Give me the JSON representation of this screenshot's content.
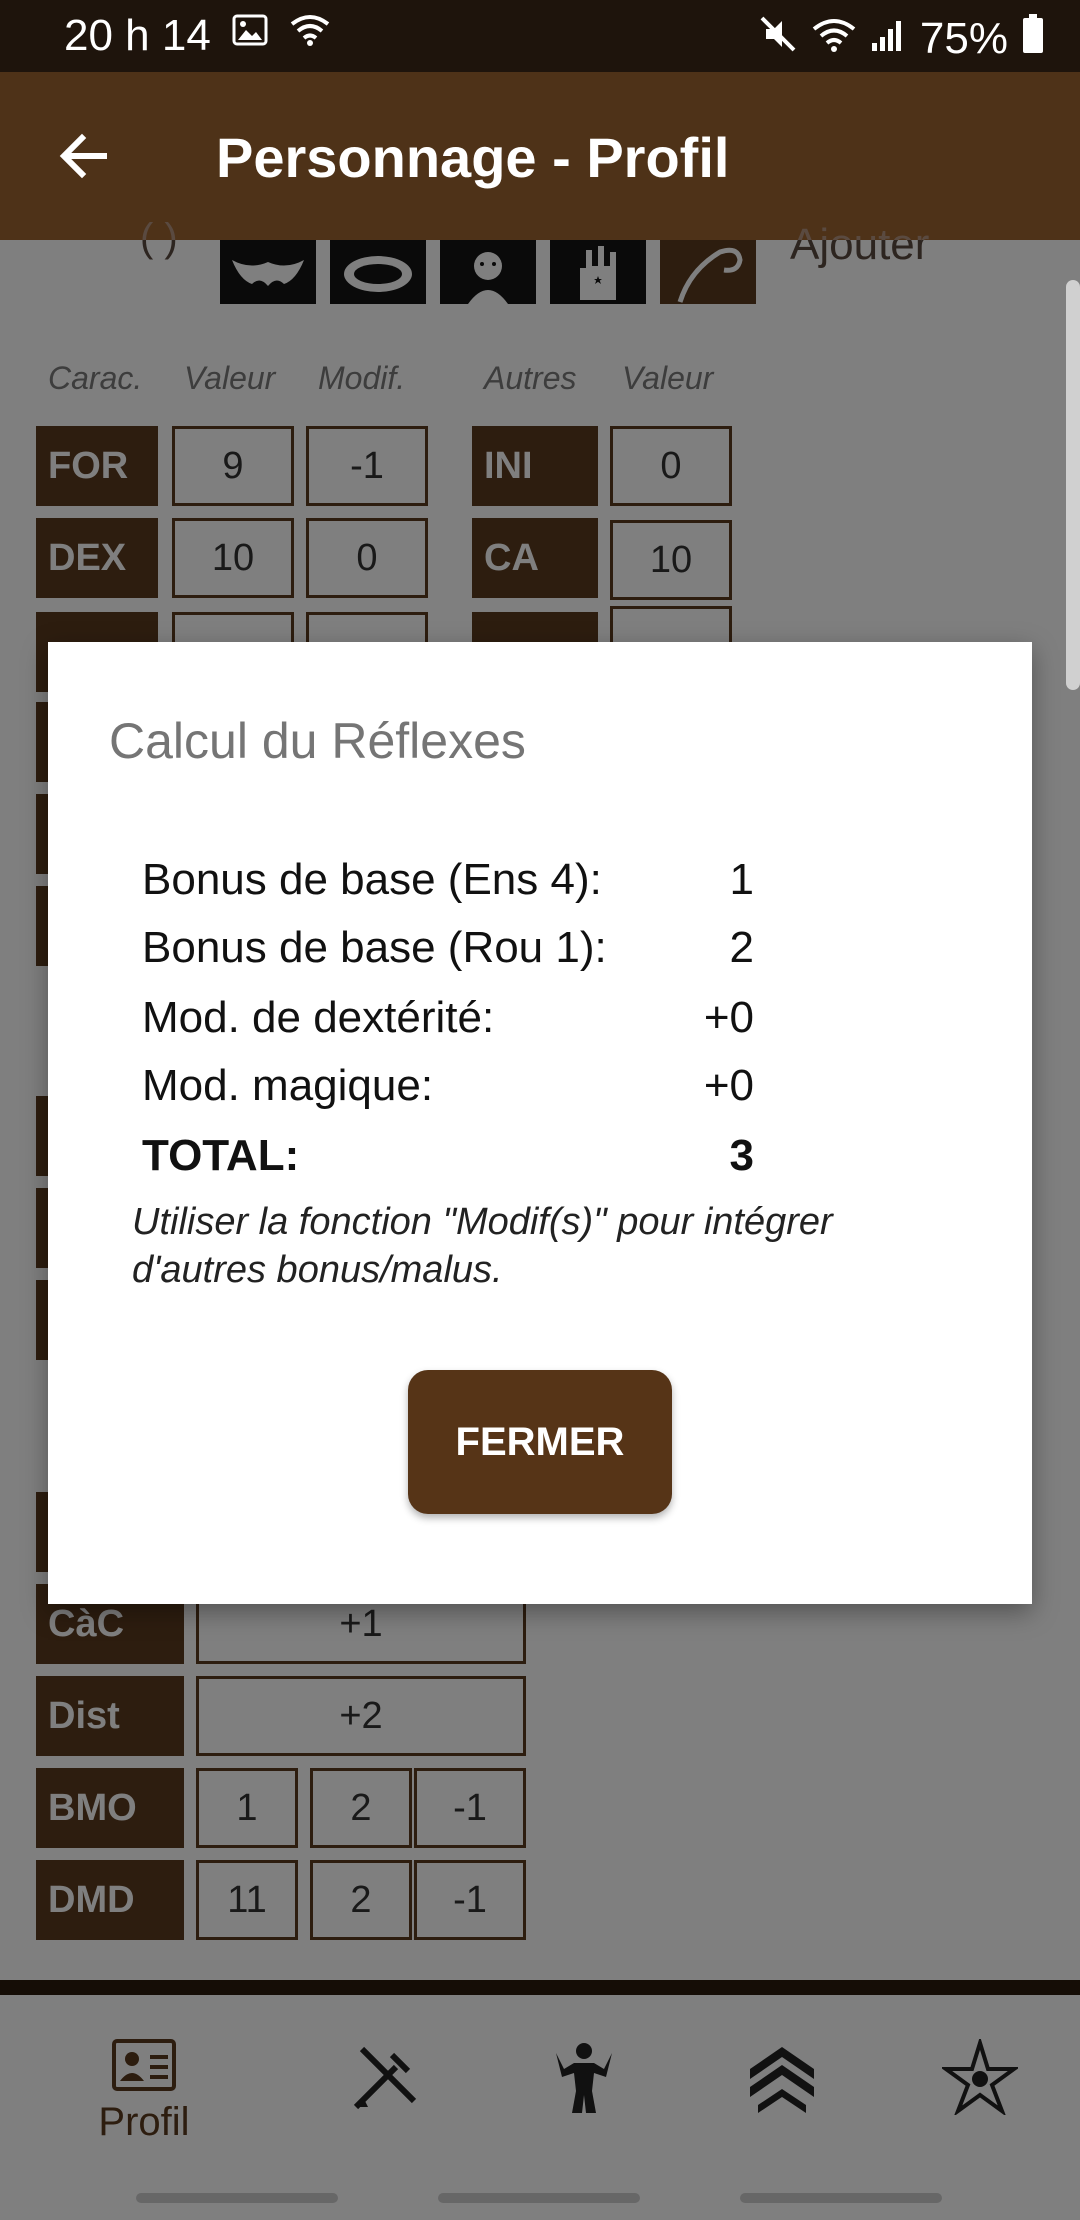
{
  "status_bar": {
    "time": "20 h 14",
    "battery": "75%",
    "left_icons": [
      "image-icon",
      "wifi-icon"
    ],
    "right_icons": [
      "mute-icon",
      "wifi-icon",
      "signal-icon",
      "battery-icon"
    ]
  },
  "app_bar": {
    "title": "Personnage - Profil",
    "back_icon": "arrow-left-icon"
  },
  "page": {
    "paren_text": "( )",
    "add_label": "Ajouter",
    "headers": {
      "carac": "Carac.",
      "valeur": "Valeur",
      "modif": "Modif.",
      "autres": "Autres",
      "valeur2": "Valeur"
    },
    "stats": [
      {
        "label": "FOR",
        "value": "9",
        "modif": "-1"
      },
      {
        "label": "DEX",
        "value": "10",
        "modif": "0"
      }
    ],
    "others": [
      {
        "label": "INI",
        "value": "0"
      },
      {
        "label": "CA",
        "value": "10"
      }
    ],
    "combat": [
      {
        "label": "CàC",
        "value": "+1"
      },
      {
        "label": "Dist",
        "value": "+2"
      }
    ],
    "maneuvers": [
      {
        "label": "BMO",
        "a": "1",
        "b": "2",
        "c": "-1"
      },
      {
        "label": "DMD",
        "a": "11",
        "b": "2",
        "c": "-1"
      }
    ]
  },
  "dialog": {
    "title": "Calcul du Réflexes",
    "rows": [
      {
        "label": "Bonus de base (Ens 4):",
        "value": "1"
      },
      {
        "label": "Bonus de base (Rou 1):",
        "value": "2"
      },
      {
        "label": "Mod. de dextérité:",
        "value": "+0"
      },
      {
        "label": "Mod. magique:",
        "value": "+0"
      }
    ],
    "total": {
      "label": "TOTAL:",
      "value": "3"
    },
    "note": "Utiliser la fonction \"Modif(s)\" pour intégrer d'autres bonus/malus.",
    "close_button": "FERMER"
  },
  "bottom_nav": {
    "items": [
      {
        "icon": "profile-card-icon",
        "label": "Profil"
      },
      {
        "icon": "weapons-icon",
        "label": ""
      },
      {
        "icon": "strongman-icon",
        "label": ""
      },
      {
        "icon": "rank-chevrons-icon",
        "label": ""
      },
      {
        "icon": "star-of-magic-icon",
        "label": ""
      }
    ]
  },
  "colors": {
    "status_bar": "#1e140c",
    "app_bar": "#4e3218",
    "accent_brown": "#5a3a1e",
    "button": "#563417"
  }
}
